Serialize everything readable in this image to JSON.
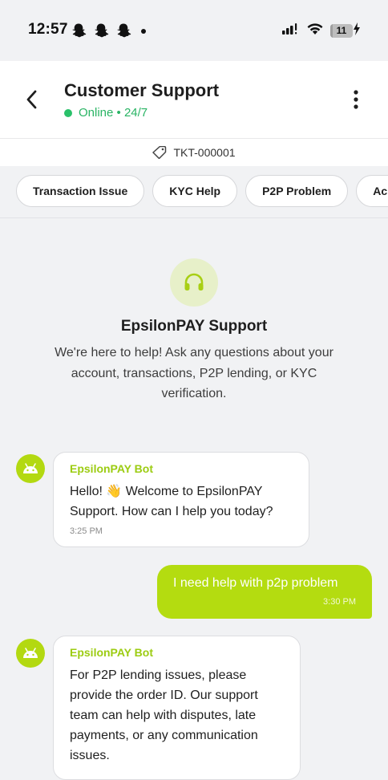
{
  "status_bar": {
    "time": "12:57",
    "battery": "11",
    "battery_level": 0.11,
    "icons": [
      "snapchat-ghost-icon",
      "snapchat-ghost-icon",
      "snapchat-ghost-icon",
      "signal-icon",
      "wifi-icon",
      "battery-icon",
      "charging-icon"
    ]
  },
  "header": {
    "title": "Customer Support",
    "status": "Online • 24/7",
    "status_color": "#2ac16a",
    "back_icon": "chevron-left-icon",
    "menu_icon": "more-vertical-icon"
  },
  "ticket": {
    "id": "TKT-000001",
    "icon": "ticket-icon"
  },
  "quick_actions": [
    {
      "label": "Transaction Issue"
    },
    {
      "label": "KYC Help"
    },
    {
      "label": "P2P Problem"
    },
    {
      "label": "Ac"
    }
  ],
  "welcome": {
    "icon": "headphones-icon",
    "title": "EpsilonPAY Support",
    "text": "We're here to help! Ask any questions about your account, transactions, P2P lending, or KYC verification."
  },
  "messages": [
    {
      "sender": "EpsilonPAY Bot",
      "type": "bot",
      "text": "Hello! 👋 Welcome to EpsilonPAY Support. How can I help you today?",
      "time": "3:25 PM"
    },
    {
      "sender": "user",
      "type": "user",
      "text": "I need help with p2p problem",
      "time": "3:30 PM"
    },
    {
      "sender": "EpsilonPAY Bot",
      "type": "bot",
      "text": "For P2P lending issues, please provide the order ID. Our support team can help with disputes, late payments, or any communication issues."
    }
  ],
  "colors": {
    "accent": "#b4dc10",
    "bot_name": "#9ccc12",
    "background": "#f1f2f4"
  }
}
